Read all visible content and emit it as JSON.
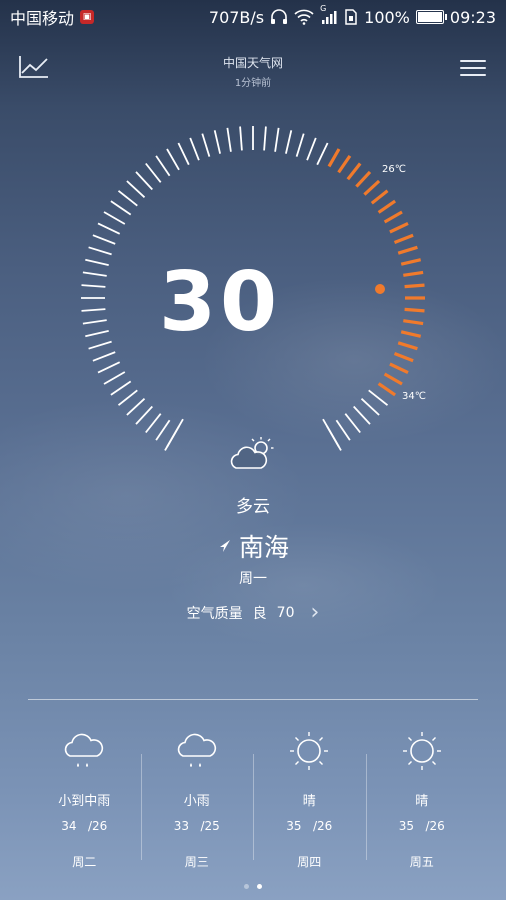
{
  "status_bar": {
    "carrier": "中国移动",
    "speed": "707B/s",
    "network": "G",
    "battery": "100%",
    "battery_level": 1.0,
    "time": "09:23"
  },
  "header": {
    "source": "中国天气网",
    "updated": "1分钟前"
  },
  "current": {
    "temperature": "30",
    "low_label": "26℃",
    "high_label": "34℃",
    "condition": "多云",
    "location": "南海",
    "weekday": "周一",
    "air_quality_label": "空气质量",
    "air_quality_level": "良",
    "air_quality_value": "70",
    "icon": "partly-cloudy-icon"
  },
  "forecast": [
    {
      "condition": "小到中雨",
      "high": "34",
      "low": "/26",
      "day": "周二",
      "icon": "rain-cloud-icon"
    },
    {
      "condition": "小雨",
      "high": "33",
      "low": "/25",
      "day": "周三",
      "icon": "rain-cloud-icon"
    },
    {
      "condition": "晴",
      "high": "35",
      "low": "/26",
      "day": "周四",
      "icon": "sun-icon"
    },
    {
      "condition": "晴",
      "high": "35",
      "low": "/26",
      "day": "周五",
      "icon": "sun-icon"
    }
  ],
  "colors": {
    "accent": "#f07a2c",
    "tick": "#ffffff"
  },
  "pager": {
    "pages": 2,
    "active": 1
  }
}
